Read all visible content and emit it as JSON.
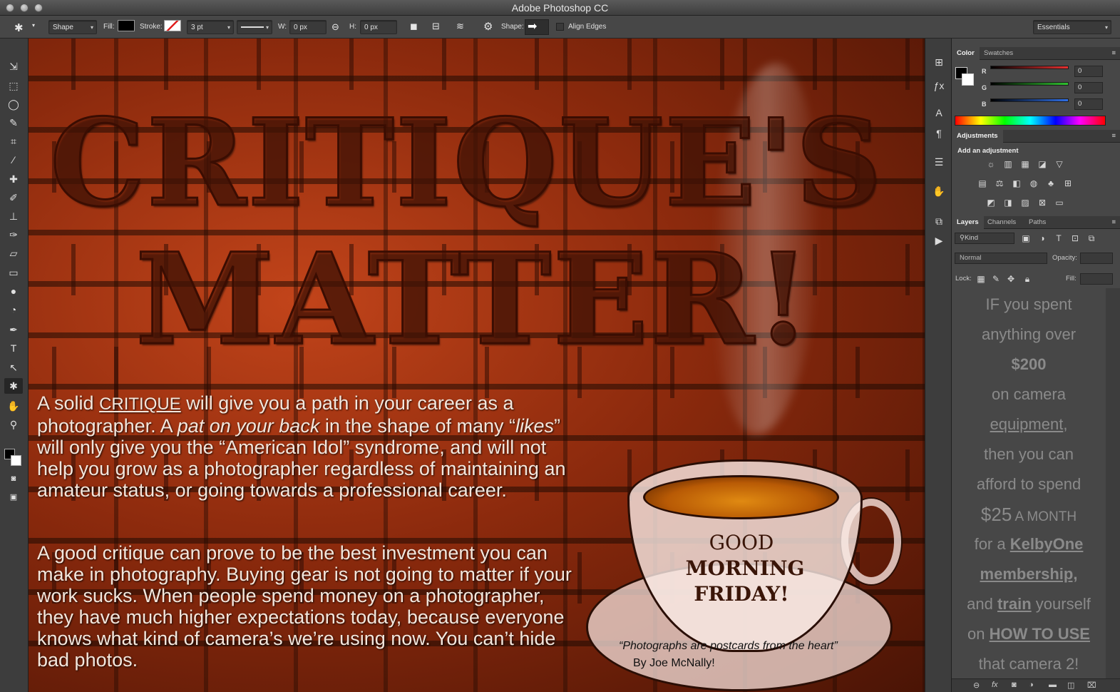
{
  "app": {
    "title": "Adobe Photoshop CC"
  },
  "options_bar": {
    "mode": "Shape",
    "fill_label": "Fill:",
    "stroke_label": "Stroke:",
    "stroke_width": "3 pt",
    "w_label": "W:",
    "w_value": "0 px",
    "h_label": "H:",
    "h_value": "0 px",
    "shape_label": "Shape:",
    "align_edges": "Align Edges",
    "workspace": "Essentials"
  },
  "canvas": {
    "headline_line1": "CRITIQUE'S",
    "headline_line2": "MATTER!",
    "para1": {
      "t1": "A solid ",
      "critique": "CRITIQUE",
      "t2": " will give you a path in your career as a photographer. A ",
      "pat": "pat on your back",
      "t3": " in the shape of many “",
      "likes": "likes",
      "t4": "” will only give you the “American Idol” syndrome, and will not help you grow as a photographer regardless of maintaining an amateur status, or going towards a professional career."
    },
    "para2": "A good critique can prove to be the best investment you can make in photography. Buying gear is not going to matter if your work sucks. When people spend money on a photographer, they have much higher expectations today, because everyone knows what kind of camera’s we’re using now. You can’t hide bad photos.",
    "cup_line1": "GOOD",
    "cup_line2": "MORNING",
    "cup_line3": "FRIDAY!",
    "quote": "“Photographs are postcards from the heart”",
    "quote_by": "By Joe McNally!"
  },
  "color_panel": {
    "tabs": [
      "Color",
      "Swatches"
    ],
    "r_label": "R",
    "g_label": "G",
    "b_label": "B",
    "r": "0",
    "g": "0",
    "b": "0"
  },
  "adjustments_panel": {
    "tab": "Adjustments",
    "heading": "Add an adjustment"
  },
  "layers_panel": {
    "tabs": [
      "Layers",
      "Channels",
      "Paths"
    ],
    "kind": "Kind",
    "blend_mode": "Normal",
    "opacity_label": "Opacity:",
    "lock_label": "Lock:",
    "fill_label": "Fill:"
  },
  "note": {
    "l1": "IF you spent",
    "l2": "anything over",
    "l3": "$200",
    "l4": "on camera",
    "l5": "equipment",
    "l5b": ",",
    "l6": "then you can",
    "l7": "afford to spend",
    "l8a": "$25",
    "l8b": " A MONTH",
    "l9a": "for a ",
    "l9b": "KelbyOne",
    "l10": "membership,",
    "l11a": "and ",
    "l11b": "train",
    "l11c": " yourself",
    "l12a": "on ",
    "l12b": "HOW TO USE",
    "l13": "that camera 2!"
  },
  "colors": {
    "accent_red": "#e53030",
    "accent_green": "#2fbf2f",
    "accent_blue": "#2f6fe5",
    "brick": "#a8350f"
  }
}
